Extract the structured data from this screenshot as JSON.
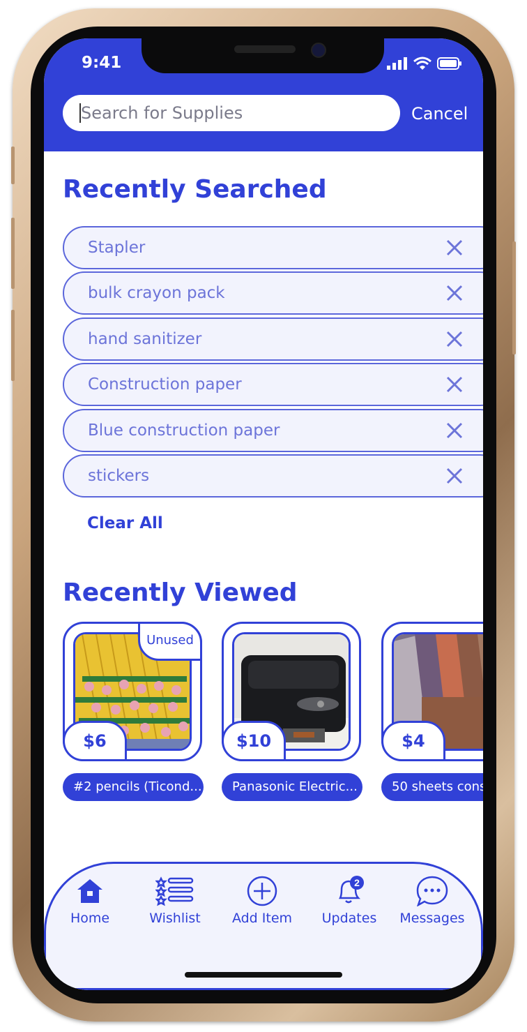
{
  "status_bar": {
    "time": "9:41"
  },
  "search": {
    "placeholder": "Search for Supplies",
    "cancel_label": "Cancel"
  },
  "recently_searched": {
    "heading": "Recently Searched",
    "items": [
      "Stapler",
      "bulk crayon pack",
      "hand sanitizer",
      "Construction paper",
      "Blue construction paper",
      "stickers"
    ],
    "clear_all_label": "Clear All"
  },
  "recently_viewed": {
    "heading": "Recently Viewed",
    "items": [
      {
        "title": "#2 pencils (Ticond...",
        "price": "$6",
        "badge": "Unused"
      },
      {
        "title": "Panasonic Electric...",
        "price": "$10"
      },
      {
        "title": "50 sheets cons",
        "price": "$4"
      }
    ]
  },
  "tabbar": {
    "tabs": [
      {
        "label": "Home",
        "icon": "home-icon"
      },
      {
        "label": "Wishlist",
        "icon": "wishlist-icon"
      },
      {
        "label": "Add Item",
        "icon": "plus-circle-icon"
      },
      {
        "label": "Updates",
        "icon": "bell-icon",
        "badge": "2"
      },
      {
        "label": "Messages",
        "icon": "chat-bubble-icon"
      }
    ]
  },
  "colors": {
    "brand": "#3141d7",
    "pill_bg": "#f2f3fd",
    "pill_text": "#6c74d9"
  }
}
